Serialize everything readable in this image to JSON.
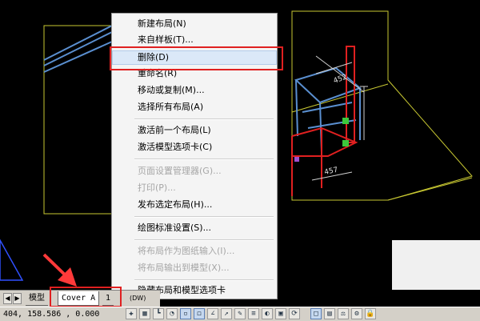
{
  "menu": {
    "items": [
      {
        "label": "新建布局(N)",
        "enabled": true
      },
      {
        "label": "来自样板(T)...",
        "enabled": true
      },
      {
        "label": "删除(D)",
        "enabled": true,
        "highlighted": true
      },
      {
        "label": "重命名(R)",
        "enabled": true
      },
      {
        "label": "移动或复制(M)...",
        "enabled": true
      },
      {
        "label": "选择所有布局(A)",
        "enabled": true
      },
      {
        "label": "激活前一个布局(L)",
        "enabled": true
      },
      {
        "label": "激活模型选项卡(C)",
        "enabled": true
      },
      {
        "label": "页面设置管理器(G)...",
        "enabled": false
      },
      {
        "label": "打印(P)...",
        "enabled": false
      },
      {
        "label": "发布选定布局(H)...",
        "enabled": true
      },
      {
        "label": "绘图标准设置(S)...",
        "enabled": true
      },
      {
        "label": "将布局作为图纸输入(I)...",
        "enabled": false
      },
      {
        "label": "将布局输出到模型(X)...",
        "enabled": false
      },
      {
        "label": "隐藏布局和模型选项卡",
        "enabled": true
      }
    ]
  },
  "tabs": {
    "nav": [
      "◀",
      "▶"
    ],
    "items": [
      {
        "label": "模型",
        "active": false
      },
      {
        "label": "Cover A",
        "active": true
      },
      {
        "label": "1",
        "active": false
      }
    ],
    "overflow": "(DW)"
  },
  "status": {
    "coords": "404, 158.586 , 0.000"
  },
  "drawing": {
    "dims": [
      "452",
      "457"
    ]
  },
  "colors": {
    "highlight_box": "#e02020",
    "cad_frame": "#c8c832",
    "model_blue": "#5a8fd0",
    "model_red": "#e02020"
  }
}
